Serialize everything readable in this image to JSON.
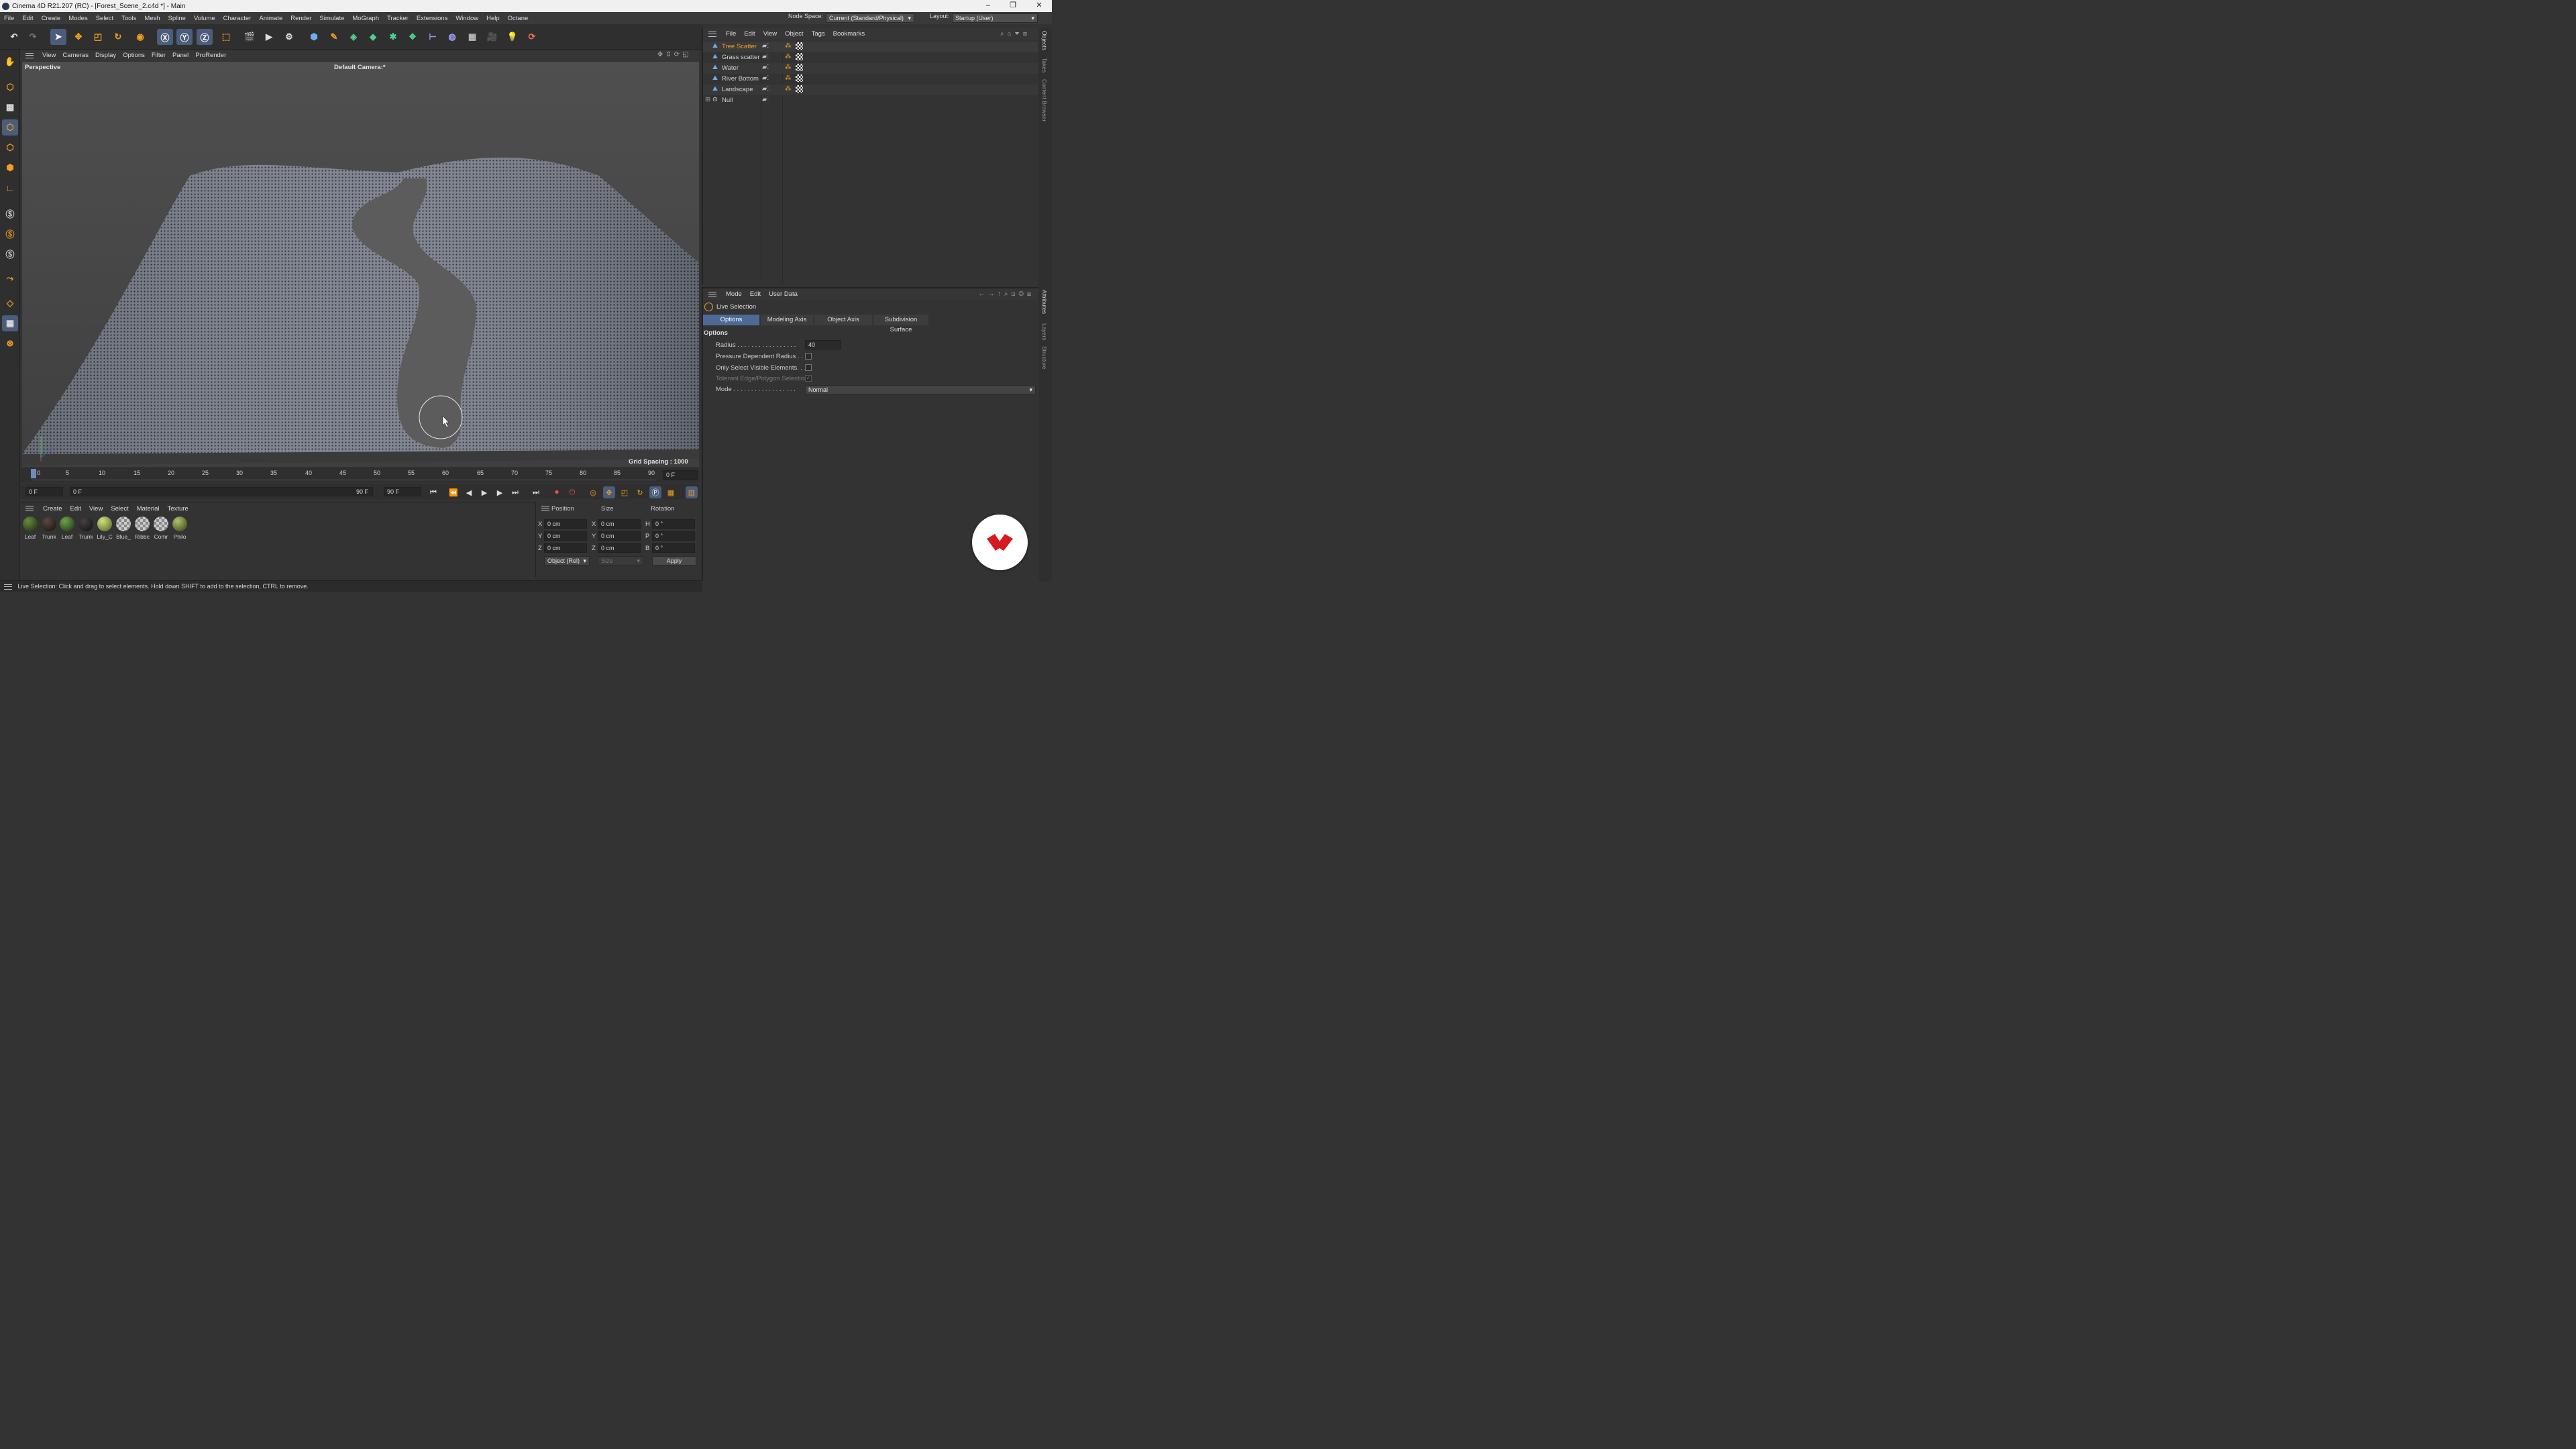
{
  "window": {
    "title": "Cinema 4D R21.207 (RC) - [Forest_Scene_2.c4d *] - Main",
    "minimize": "–",
    "maximize": "❐",
    "close": "✕"
  },
  "menu": [
    "File",
    "Edit",
    "Create",
    "Modes",
    "Select",
    "Tools",
    "Mesh",
    "Spline",
    "Volume",
    "Character",
    "Animate",
    "Render",
    "Simulate",
    "MoGraph",
    "Tracker",
    "Extensions",
    "Window",
    "Help",
    "Octane"
  ],
  "node_space": {
    "label": "Node Space:",
    "value": "Current (Standard/Physical)"
  },
  "layout": {
    "label": "Layout:",
    "value": "Startup (User)"
  },
  "viewport": {
    "menu": [
      "View",
      "Cameras",
      "Display",
      "Options",
      "Filter",
      "Panel",
      "ProRender"
    ],
    "view_name": "Perspective",
    "camera": "Default Camera",
    "camera_suffix": ":*",
    "grid_spacing": "Grid Spacing : 1000 cm"
  },
  "timeline": {
    "ticks": [
      "0",
      "5",
      "10",
      "15",
      "20",
      "25",
      "30",
      "35",
      "40",
      "45",
      "50",
      "55",
      "60",
      "65",
      "70",
      "75",
      "80",
      "85",
      "90"
    ],
    "current_frame_right": "0 F"
  },
  "playback": {
    "start": "0 F",
    "range_start": "0 F",
    "range_end": "90 F",
    "end": "90 F"
  },
  "materials": {
    "menu": [
      "Create",
      "Edit",
      "View",
      "Select",
      "Material",
      "Texture"
    ],
    "items": [
      "Leaf",
      "Trunk",
      "Leaf",
      "Trunk",
      "Lily_C",
      "Blue_",
      "Ribbc",
      "Comr",
      "Philo"
    ]
  },
  "coords": {
    "headers": [
      "Position",
      "Size",
      "Rotation"
    ],
    "rows": [
      {
        "a": "X",
        "pos": "0 cm",
        "b": "X",
        "size": "0 cm",
        "c": "H",
        "rot": "0 °"
      },
      {
        "a": "Y",
        "pos": "0 cm",
        "b": "Y",
        "size": "0 cm",
        "c": "P",
        "rot": "0 °"
      },
      {
        "a": "Z",
        "pos": "0 cm",
        "b": "Z",
        "size": "0 cm",
        "c": "B",
        "rot": "0 °"
      }
    ],
    "mode": "Object (Rel)",
    "size_mode": "Size",
    "apply": "Apply"
  },
  "status": "Live Selection: Click and drag to select elements. Hold down SHIFT to add to the selection, CTRL to remove.",
  "objects": {
    "menu": [
      "File",
      "Edit",
      "View",
      "Object",
      "Tags",
      "Bookmarks"
    ],
    "items": [
      "Tree Scatter",
      "Grass scatter",
      "Water",
      "River Bottom",
      "Landscape",
      "Null"
    ]
  },
  "attributes": {
    "menu": [
      "Mode",
      "Edit",
      "User Data"
    ],
    "tool": "Live Selection",
    "tabs": [
      "Options",
      "Modeling Axis",
      "Object Axis",
      "Subdivision Surface"
    ],
    "section": "Options",
    "radius_label": "Radius . . . . . . . . . . . . . . . . .",
    "radius": "40",
    "pressure": "Pressure Dependent Radius . . .",
    "visible": "Only Select Visible Elements. . .",
    "tolerant": "Tolerant Edge/Polygon Selection",
    "mode_label": "Mode . . . . . . . . . . . . . . . . . .",
    "mode": "Normal"
  },
  "side_tabs": [
    "Objects",
    "Takes",
    "Content Browser",
    "Attributes",
    "Layers",
    "Structure"
  ],
  "accent": "#4d6a96",
  "highlight": "#f0a020"
}
